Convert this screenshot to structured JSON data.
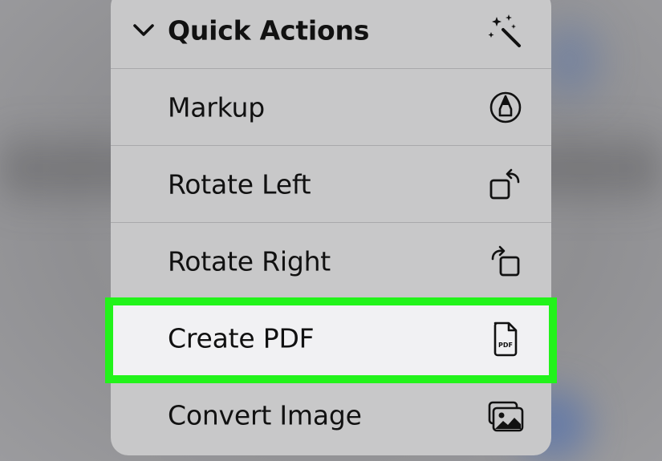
{
  "menu": {
    "header": {
      "title": "Quick Actions",
      "chevron_icon": "chevron-down-icon",
      "icon": "magic-wand-icon"
    },
    "items": [
      {
        "label": "Markup",
        "icon": "markup-pen-circle-icon"
      },
      {
        "label": "Rotate Left",
        "icon": "rotate-left-icon"
      },
      {
        "label": "Rotate Right",
        "icon": "rotate-right-icon"
      },
      {
        "label": "Create PDF",
        "icon": "pdf-document-icon",
        "icon_text": "PDF",
        "selected": true
      },
      {
        "label": "Convert Image",
        "icon": "photos-stack-icon"
      }
    ]
  },
  "colors": {
    "menu_bg": "#c8c8c9",
    "selected_row_bg": "#f1f1f3",
    "highlight_border": "#22f31a"
  }
}
